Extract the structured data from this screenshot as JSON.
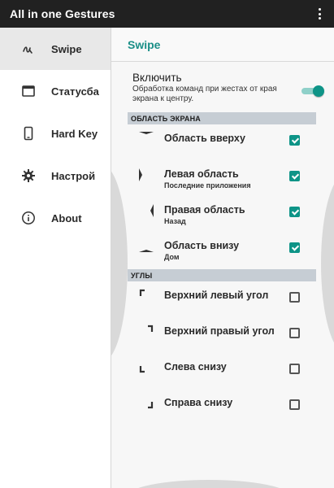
{
  "appbar": {
    "title": "All in one Gestures",
    "menu_icon": "more-vertical-icon"
  },
  "sidebar": {
    "items": [
      {
        "label": "Swipe",
        "icon": "swipe-icon",
        "active": true
      },
      {
        "label": "Статусба",
        "icon": "statusbar-icon",
        "active": false
      },
      {
        "label": "Hard Key",
        "icon": "phone-icon",
        "active": false
      },
      {
        "label": "Настрой",
        "icon": "gear-icon",
        "active": false
      },
      {
        "label": "About",
        "icon": "info-icon",
        "active": false
      }
    ]
  },
  "main": {
    "title": "Swipe",
    "enable": {
      "title": "Включить",
      "description": "Обработка команд при жестах от края экрана к центру.",
      "on": true
    },
    "areas_header": "ОБЛАСТЬ ЭКРАНА",
    "areas": [
      {
        "title": "Область вверху",
        "subtitle": "",
        "checked": true
      },
      {
        "title": "Левая область",
        "subtitle": "Последние приложения",
        "checked": true
      },
      {
        "title": "Правая область",
        "subtitle": "Назад",
        "checked": true
      },
      {
        "title": "Область внизу",
        "subtitle": "Дом",
        "checked": true
      }
    ],
    "corners_header": "УГЛЫ",
    "corners": [
      {
        "title": "Верхний левый угол",
        "checked": false
      },
      {
        "title": "Верхний правый угол",
        "checked": false
      },
      {
        "title": "Слева снизу",
        "checked": false
      },
      {
        "title": "Справа снизу",
        "checked": false
      }
    ]
  },
  "colors": {
    "accent": "#0e9487",
    "appbar": "#212121",
    "group_header": "#c6cdd4"
  }
}
